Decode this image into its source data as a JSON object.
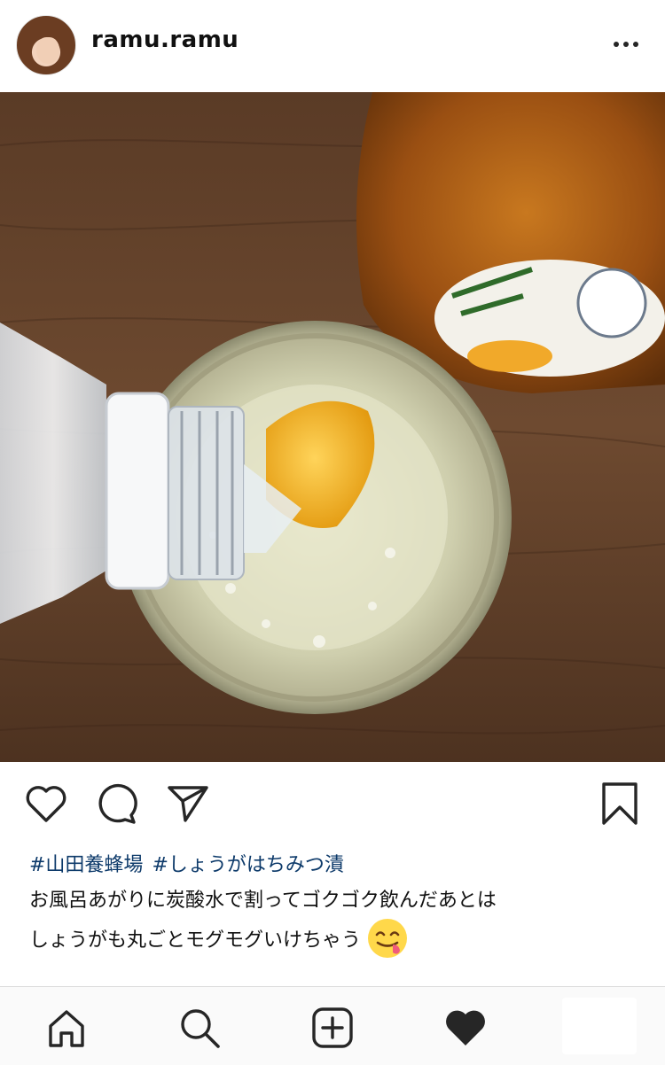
{
  "post": {
    "username": "ramu.ramu",
    "avatar_icon": "profile-avatar",
    "hashtags": [
      "#山田養蜂場",
      "#しょうがはちみつ漬"
    ],
    "caption_lines": [
      "お風呂あがりに炭酸水で割ってゴクゴク飲んだあとは",
      "しょうがも丸ごとモグモグいけちゃう"
    ],
    "caption_emoji": "yum-face-emoji"
  },
  "actions": {
    "like_icon": "heart-outline-icon",
    "comment_icon": "comment-icon",
    "share_icon": "send-icon",
    "save_icon": "bookmark-icon"
  },
  "nav": {
    "items": [
      "home-icon",
      "search-icon",
      "add-post-icon",
      "activity-heart-icon"
    ]
  },
  "colors": {
    "hashtag": "#0d3a6a",
    "text": "#111111",
    "navbar_bg": "#fafafa",
    "divider": "#dbdbdb"
  }
}
